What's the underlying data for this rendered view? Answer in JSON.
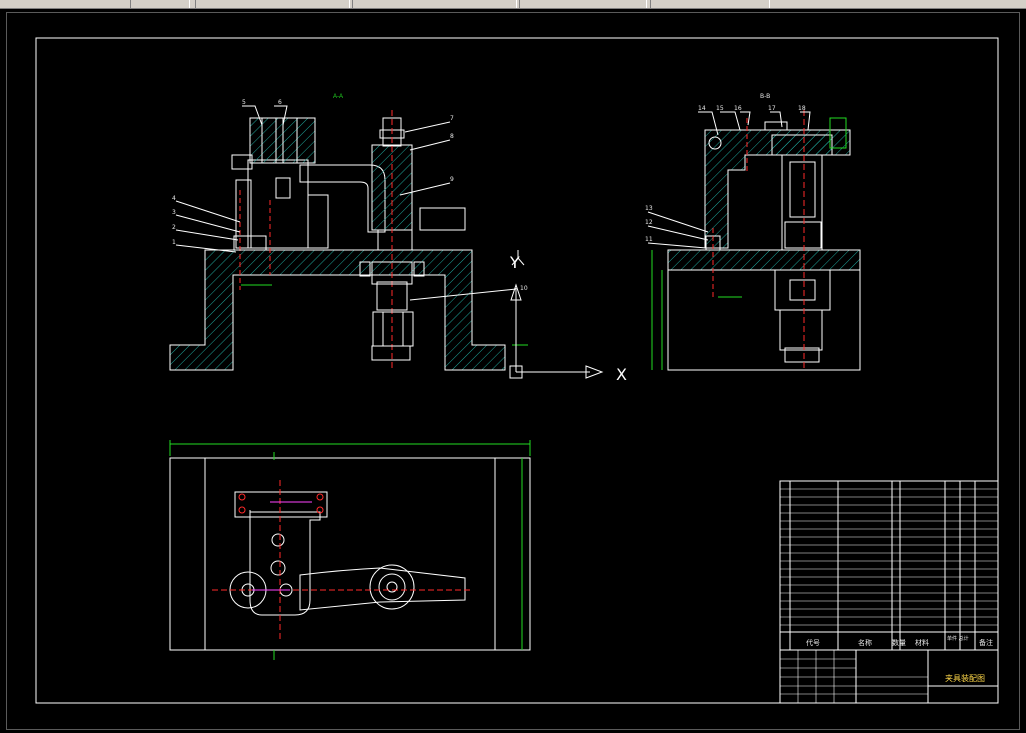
{
  "app": {
    "colors": {
      "background": "#000000",
      "line": "#ffffff",
      "hatch": "#1fa59a",
      "dimension": "#22dd22",
      "center": "#ff2a2a",
      "highlight": "#ff44ff",
      "text": "#e8e8e8"
    }
  },
  "axes": {
    "y_label": "Y",
    "x_label": "X"
  },
  "title_block": {
    "drawing_title": "夹具装配图",
    "columns": {
      "code": "代号",
      "name": "名称",
      "qty": "数量",
      "material": "材料",
      "weight": "单件 总计",
      "remark": "备注"
    }
  }
}
